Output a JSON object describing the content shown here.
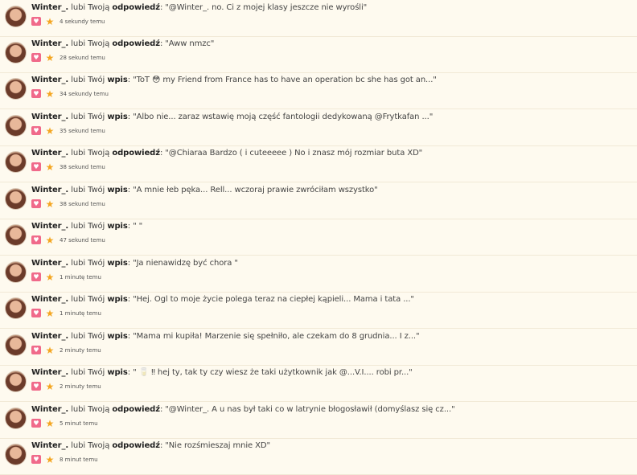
{
  "notifications": [
    {
      "user": "Winter_.",
      "action": "lubi Twoją",
      "type": "odpowiedź",
      "quote": "\"@Winter_. no. Ci z mojej klasy jeszcze nie wyrośli\"",
      "time": "4 sekundy temu"
    },
    {
      "user": "Winter_.",
      "action": "lubi Twoją",
      "type": "odpowiedź",
      "quote": "\"Aww nmzc\"",
      "time": "28 sekund temu"
    },
    {
      "user": "Winter_.",
      "action": "lubi Twój",
      "type": "wpis",
      "quote": "\"ToT 😳 my Friend from France has to have an operation bc she has got an...\"",
      "time": "34 sekundy temu"
    },
    {
      "user": "Winter_.",
      "action": "lubi Twój",
      "type": "wpis",
      "quote": "\"Albo nie... zaraz wstawię moją część fantologii dedykowaną @Frytkafan ...\"",
      "time": "35 sekund temu"
    },
    {
      "user": "Winter_.",
      "action": "lubi Twoją",
      "type": "odpowiedź",
      "quote": "\"@Chiaraa Bardzo ( i cuteeeee ) No i znasz mój rozmiar buta XD\"",
      "time": "38 sekund temu"
    },
    {
      "user": "Winter_.",
      "action": "lubi Twój",
      "type": "wpis",
      "quote": "\"A mnie łeb pęka... Rell... wczoraj prawie zwróciłam wszystko\"",
      "time": "38 sekund temu"
    },
    {
      "user": "Winter_.",
      "action": "lubi Twój",
      "type": "wpis",
      "quote": "\" \"",
      "time": "47 sekund temu"
    },
    {
      "user": "Winter_.",
      "action": "lubi Twój",
      "type": "wpis",
      "quote": "\"Ja nienawidzę być chora \"",
      "time": "1 minutę temu"
    },
    {
      "user": "Winter_.",
      "action": "lubi Twój",
      "type": "wpis",
      "quote": "\"Hej. Ogl to moje życie polega teraz na ciepłej kąpieli... Mama i tata ...\"",
      "time": "1 minutę temu"
    },
    {
      "user": "Winter_.",
      "action": "lubi Twój",
      "type": "wpis",
      "quote": "\"Mama mi kupiła! Marzenie się spełniło, ale czekam do 8 grudnia... I z...\"",
      "time": "2 minuty temu"
    },
    {
      "user": "Winter_.",
      "action": "lubi Twój",
      "type": "wpis",
      "quote": "\" 🥛 ‼ hej ty, tak ty czy wiesz że taki użytkownik jak @...V.I.... robi pr...\"",
      "time": "2 minuty temu"
    },
    {
      "user": "Winter_.",
      "action": "lubi Twoją",
      "type": "odpowiedź",
      "quote": "\"@Winter_. A u nas był taki co w latrynie błogosławił (domyślasz się cz...\"",
      "time": "5 minut temu"
    },
    {
      "user": "Winter_.",
      "action": "lubi Twoją",
      "type": "odpowiedź",
      "quote": "\"Nie rozśmieszaj mnie XD\"",
      "time": "8 minut temu"
    }
  ],
  "icons": {
    "like": "heart-icon",
    "featured": "star-icon"
  },
  "colors": {
    "background": "#fefaef",
    "heart": "#f06a8a",
    "star": "#f4a621"
  }
}
